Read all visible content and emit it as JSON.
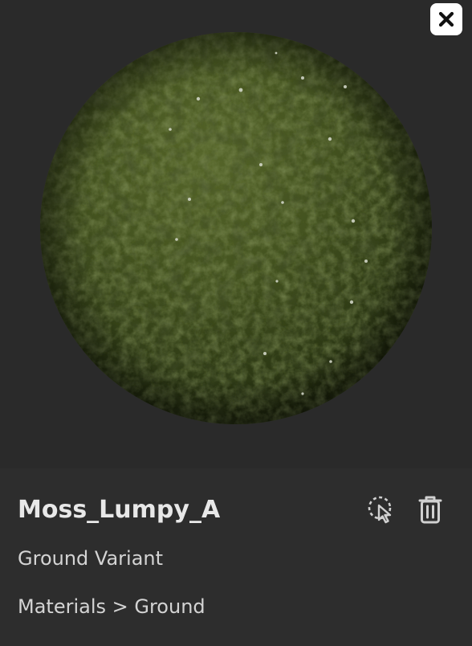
{
  "material": {
    "name": "Moss_Lumpy_A",
    "variant": "Ground Variant",
    "path": "Materials > Ground"
  },
  "icons": {
    "close": "close-icon",
    "select": "select-cursor-icon",
    "delete": "trash-icon"
  },
  "colors": {
    "moss_base": "#3d4a1f",
    "moss_light": "#5a6b2c",
    "moss_dark": "#1e260e",
    "background": "#2a2a2a",
    "panel": "#2d2d2d",
    "text_primary": "#e8e8e8",
    "text_secondary": "#d4d4d4"
  }
}
